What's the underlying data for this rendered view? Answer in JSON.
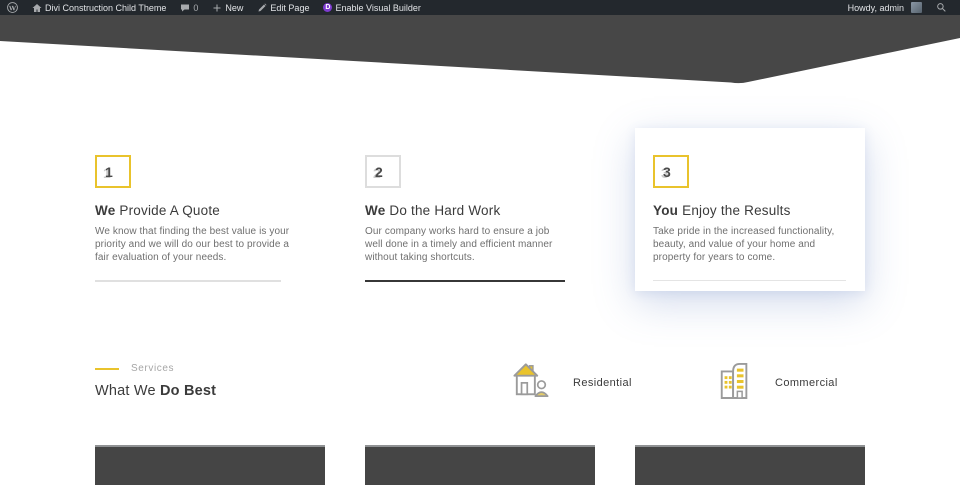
{
  "admin_bar": {
    "site_name": "Divi Construction Child Theme",
    "comment_count": "0",
    "new_label": "New",
    "edit_page_label": "Edit Page",
    "visual_builder_label": "Enable Visual Builder",
    "howdy_label": "Howdy, admin",
    "icons": [
      "wordpress-logo",
      "home-icon",
      "comments-icon",
      "plus-icon",
      "pencil-icon",
      "divi-icon",
      "avatar",
      "search-icon"
    ]
  },
  "steps": [
    {
      "number": "1",
      "title_em": "We",
      "title_rest": "Provide A Quote",
      "body": "We know that finding the best value is your priority and we will do our best to provide a fair evaluation of your needs.",
      "box_border_color": "#e9c32c",
      "divider_style": "light",
      "card": false
    },
    {
      "number": "2",
      "title_em": "We",
      "title_rest": "Do the Hard Work",
      "body": "Our company works hard to ensure a job well done in a timely and efficient manner without taking shortcuts.",
      "box_border_color": "#dddddd",
      "divider_style": "dark",
      "card": false
    },
    {
      "number": "3",
      "title_em": "You",
      "title_rest": "Enjoy the Results",
      "body": "Take pride in the increased functionality, beauty, and value of your home and property for years to come.",
      "box_border_color": "#e9c32c",
      "divider_style": "light",
      "card": true
    }
  ],
  "services": {
    "eyebrow": "Services",
    "title_normal": "What We",
    "title_bold": "Do Best",
    "categories": [
      {
        "label": "Residential",
        "icon": "house-icon"
      },
      {
        "label": "Commercial",
        "icon": "building-icon"
      }
    ]
  },
  "colors": {
    "admin_bar_bg": "#23282d",
    "divi_purple": "#7e3bd0",
    "accent_yellow": "#e9c32c",
    "header_dark": "#474747",
    "heading_text": "#3b3b3b",
    "body_text": "#6f6f6f",
    "placeholder_box": "#454545"
  }
}
